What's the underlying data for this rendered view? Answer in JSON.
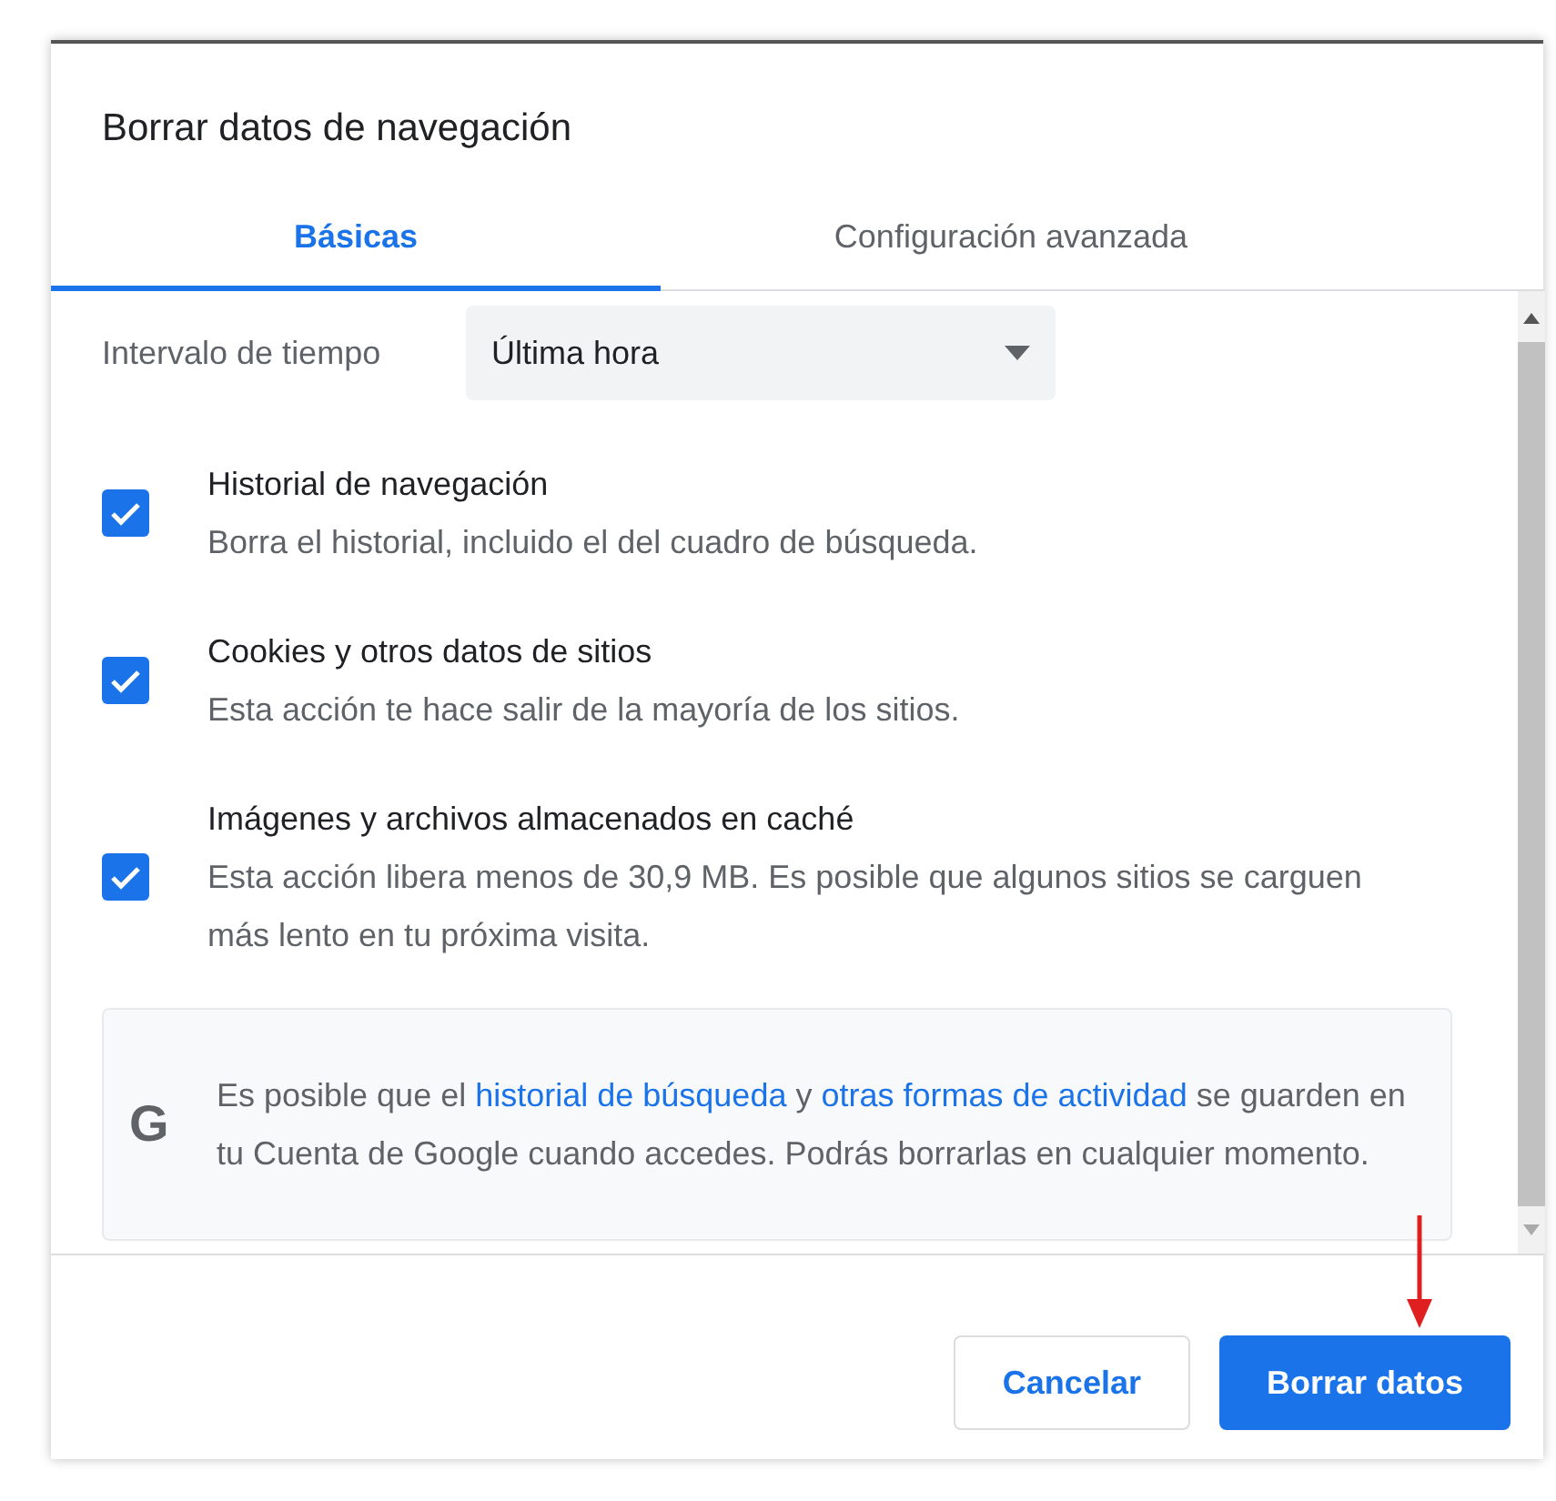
{
  "dialog": {
    "title": "Borrar datos de navegación"
  },
  "tabs": [
    {
      "label": "Básicas",
      "selected": true
    },
    {
      "label": "Configuración avanzada",
      "selected": false
    }
  ],
  "time_range": {
    "label": "Intervalo de tiempo",
    "value": "Última hora"
  },
  "options": [
    {
      "title": "Historial de navegación",
      "description": "Borra el historial, incluido el del cuadro de búsqueda.",
      "checked": true
    },
    {
      "title": "Cookies y otros datos de sitios",
      "description": "Esta acción te hace salir de la mayoría de los sitios.",
      "checked": true
    },
    {
      "title": "Imágenes y archivos almacenados en caché",
      "description": "Esta acción libera menos de 30,9 MB. Es posible que algunos sitios se carguen más lento en tu próxima visita.",
      "checked": true
    }
  ],
  "info": {
    "logo": "G",
    "parts": [
      {
        "kind": "text",
        "text": "Es posible que el "
      },
      {
        "kind": "link",
        "text": "historial de búsqueda"
      },
      {
        "kind": "text",
        "text": " y "
      },
      {
        "kind": "link",
        "text": "otras formas de actividad"
      },
      {
        "kind": "text",
        "text": " se guarden en tu Cuenta de Google cuando accedes. Podrás borrarlas en cualquier momento."
      }
    ]
  },
  "buttons": [
    {
      "label": "Cancelar",
      "kind": "secondary"
    },
    {
      "label": "Borrar datos",
      "kind": "primary"
    }
  ]
}
